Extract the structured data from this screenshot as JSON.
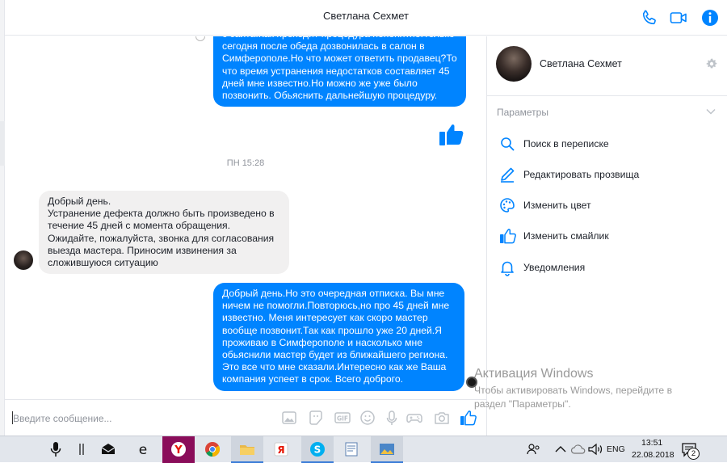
{
  "header": {
    "title": "Светлана Сехмет"
  },
  "messages": [
    {
      "side": "out",
      "text": "с сайта.Как проходит процедура непонятно.Только\nсегодня после обеда дозвонилась в салон в\nСимферополе.Но что может ответить продавец?То\nчто время устранения недостатков составляет 45\nдней мне известно.Но можно же уже было\nпозвонить. Обьяснить дальнейшую процедуру."
    },
    {
      "side": "in",
      "text": "Добрый день.\nУстранение дефекта должно быть произведено в\nтечение 45 дней с момента обращения.\nОжидайте, пожалуйста, звонка для согласования\nвыезда мастера. Приносим извинения за\nсложившуюся ситуацию"
    },
    {
      "side": "out",
      "text": "Добрый день.Но это очередная отписка. Вы мне\nничем не помогли.Повторюсь,но про 45 дней мне\nизвестно. Меня интересует как скоро мастер\nвообще позвонит.Так как прошло уже 20 дней.Я\nпроживаю в Симферополе и насколько мне\nобьяснили мастер будет из ближайшего региона.\nЭто все что мне сказали.Интересно как же Ваша\nкомпания успеет в срок. Всего доброго."
    }
  ],
  "timestamp": "ПН 15:28",
  "composer": {
    "placeholder": "Введите сообщение..."
  },
  "panel": {
    "name": "Светлана Сехмет",
    "params_label": "Параметры",
    "options": [
      {
        "label": "Поиск в переписке",
        "icon": "search-icon"
      },
      {
        "label": "Редактировать прозвища",
        "icon": "pencil-icon"
      },
      {
        "label": "Изменить цвет",
        "icon": "palette-icon"
      },
      {
        "label": "Изменить смайлик",
        "icon": "thumbs-up-icon"
      },
      {
        "label": "Уведомления",
        "icon": "bell-icon"
      }
    ]
  },
  "watermark": {
    "title": "Активация Windows",
    "subtitle": "Чтобы активировать Windows, перейдите в\nраздел \"Параметры\"."
  },
  "taskbar": {
    "language": "ENG",
    "time": "13:51",
    "date": "22.08.2018",
    "notification_count": "2"
  },
  "colors": {
    "accent": "#0084ff",
    "incoming_bubble": "#f1f0f0",
    "taskbar": "#e2e6ec"
  }
}
